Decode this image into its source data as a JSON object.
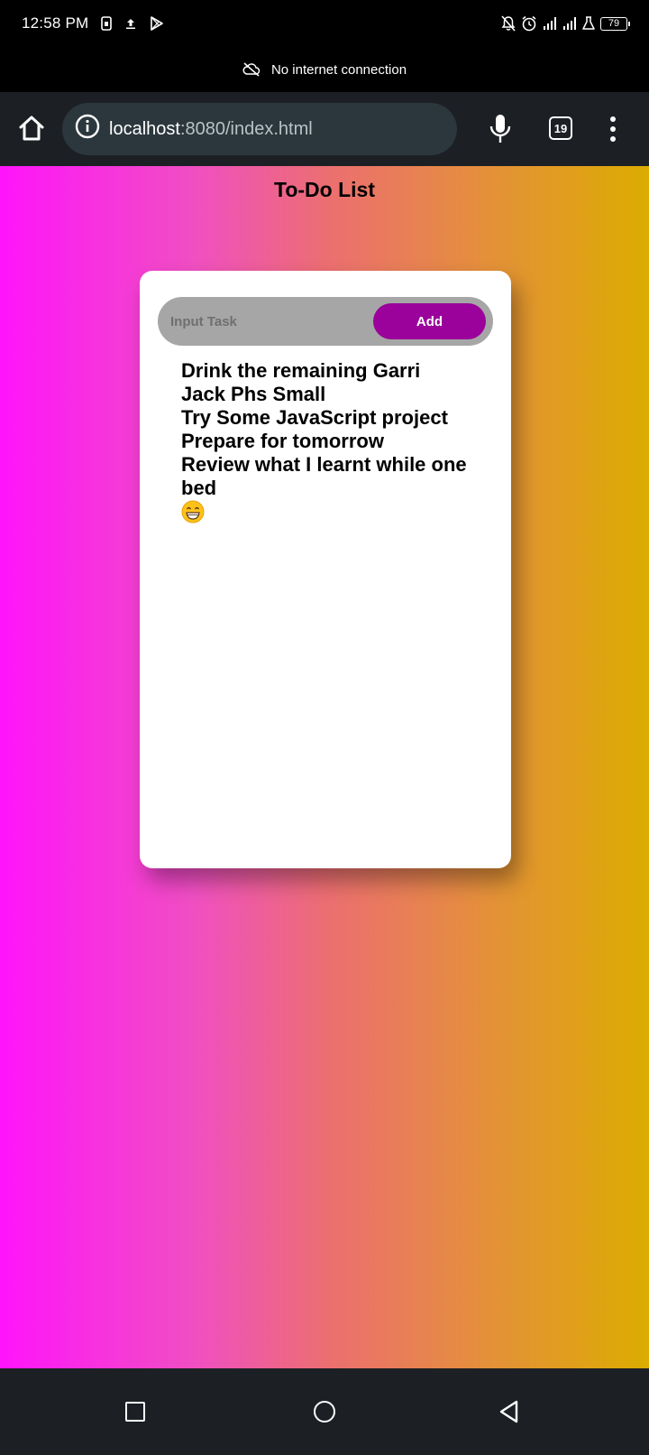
{
  "status_bar": {
    "time": "12:58 PM",
    "battery": "79"
  },
  "offline_banner": {
    "text": "No internet connection"
  },
  "browser": {
    "url_host": "localhost",
    "url_rest": ":8080/index.html",
    "tab_count": "19"
  },
  "page": {
    "title": "To-Do List",
    "input_placeholder": "Input Task",
    "add_label": "Add",
    "tasks": [
      "Drink the remaining Garri",
      "Jack Phs Small",
      "Try Some JavaScript project",
      "Prepare for tomorrow",
      "Review what I learnt while one bed"
    ]
  },
  "colors": {
    "gradient_left": "#ff14fb",
    "gradient_right": "#dcac00",
    "add_button": "#9b019b",
    "input_bg": "#a6a6a6",
    "browser_bar": "#1c2024"
  }
}
